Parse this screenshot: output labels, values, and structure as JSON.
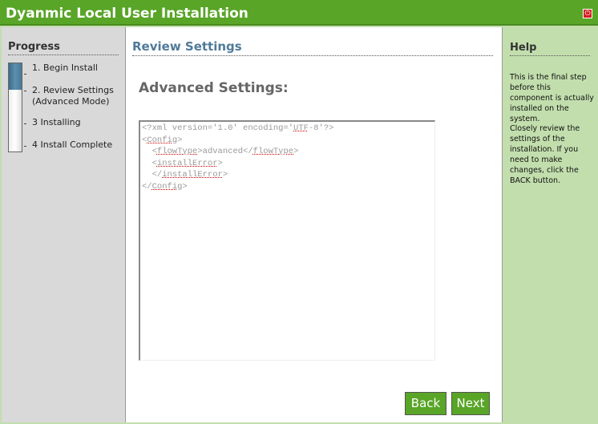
{
  "window": {
    "title": "Dyanmic Local User Installation",
    "close_icon": "power-icon"
  },
  "progress": {
    "title": "Progress",
    "fraction_complete": 0.3,
    "steps": [
      "1. Begin Install",
      "2. Review Settings",
      "(Advanced Mode)",
      "3 Installing",
      "4 Install Complete"
    ]
  },
  "main": {
    "title": "Review Settings",
    "heading": "Advanced Settings:",
    "xml": {
      "l1a": "<?xml version='1.0' encoding='",
      "l1b": "UTF",
      "l1c": "-8'?>",
      "config": "Config",
      "flowType": "flowType",
      "flowValue": "advanced",
      "installError": "installError"
    }
  },
  "buttons": {
    "back": "Back",
    "next": "Next"
  },
  "help": {
    "title": "Help",
    "p1": "This is the final step before this component is actually installed on the system.",
    "p2": "Closely review the settings of the installation. If you need to make changes, click the BACK button."
  }
}
